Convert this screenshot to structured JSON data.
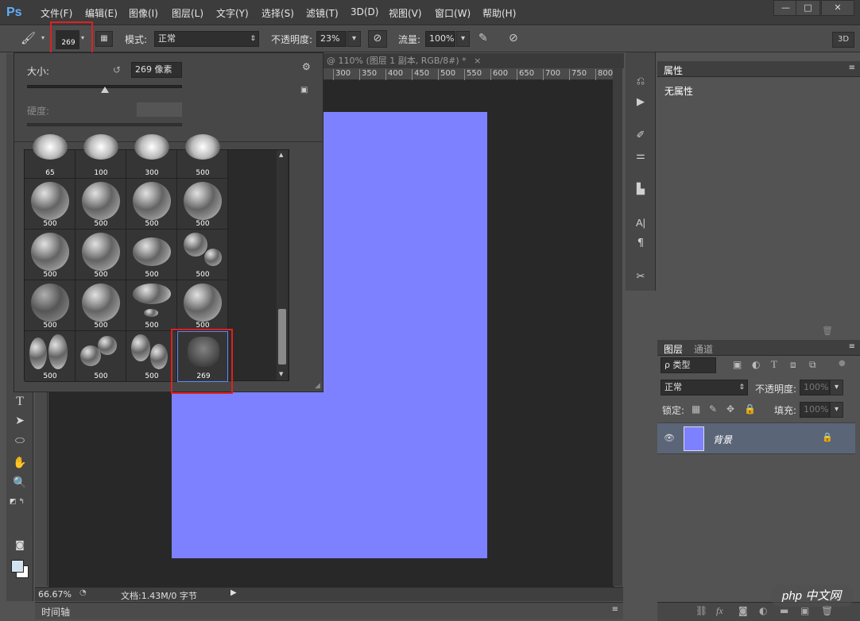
{
  "app": {
    "logo": "Ps"
  },
  "menu": [
    "文件(F)",
    "编辑(E)",
    "图像(I)",
    "图层(L)",
    "文字(Y)",
    "选择(S)",
    "滤镜(T)",
    "3D(D)",
    "视图(V)",
    "窗口(W)",
    "帮助(H)"
  ],
  "window_controls": {
    "minimize": "—",
    "restore": "□",
    "close": "✕"
  },
  "options": {
    "brush_size": "269",
    "mode_label": "模式:",
    "mode_value": "正常",
    "opacity_label": "不透明度:",
    "opacity_value": "23%",
    "flow_label": "流量:",
    "flow_value": "100%",
    "btn_3d": "3D"
  },
  "document_tab": {
    "title": "@ 110% (图层 1 副本, RGB/8#) *",
    "close": "×"
  },
  "ruler_ticks": [
    "300",
    "350",
    "400",
    "450",
    "500",
    "550",
    "600",
    "650",
    "700",
    "750",
    "800"
  ],
  "brush_popup": {
    "size_label": "大小:",
    "size_value": "269 像素",
    "hardness_label": "硬度:",
    "size_slider_fraction": 0.5
  },
  "brush_header_numbers": [
    "65",
    "100",
    "300",
    "500"
  ],
  "brush_rows": [
    [
      "500",
      "500",
      "500",
      "500"
    ],
    [
      "500",
      "500",
      "500",
      "500"
    ],
    [
      "500",
      "500",
      "500",
      "500"
    ],
    [
      "500",
      "500",
      "500",
      "269"
    ]
  ],
  "status": {
    "zoom": "66.67%",
    "doc_info": "文档:1.43M/0 字节"
  },
  "timeline": {
    "label": "时间轴"
  },
  "properties": {
    "tab": "属性",
    "content": "无属性"
  },
  "layers_panel": {
    "tabs": [
      "图层",
      "通道"
    ],
    "filter": "ρ 类型",
    "blend_mode": "正常",
    "opacity_label": "不透明度:",
    "opacity_value": "100%",
    "lock_label": "锁定:",
    "fill_label": "填充:",
    "fill_value": "100%",
    "layer_name": "背景"
  },
  "colors": {
    "document": "#7e81ff",
    "highlight": "#e02020",
    "layer_selected": "#5a6578"
  },
  "watermark": "php 中文网"
}
